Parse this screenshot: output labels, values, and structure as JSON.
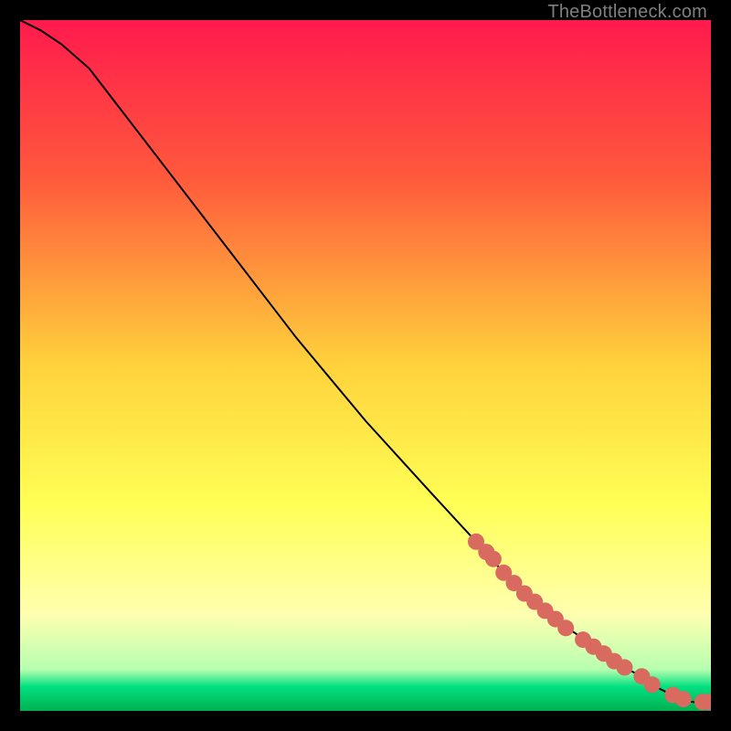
{
  "attribution": "TheBottleneck.com",
  "chart_data": {
    "type": "line",
    "title": "",
    "xlabel": "",
    "ylabel": "",
    "xlim": [
      0,
      100
    ],
    "ylim": [
      0,
      100
    ],
    "grid": false,
    "background_gradient": [
      {
        "offset": 0.0,
        "color": "#ff1a4d"
      },
      {
        "offset": 0.23,
        "color": "#ff5a3c"
      },
      {
        "offset": 0.5,
        "color": "#ffd23c"
      },
      {
        "offset": 0.7,
        "color": "#ffff55"
      },
      {
        "offset": 0.86,
        "color": "#ffffb0"
      },
      {
        "offset": 0.94,
        "color": "#b7ffb0"
      },
      {
        "offset": 0.965,
        "color": "#00e080"
      },
      {
        "offset": 1.0,
        "color": "#00b050"
      }
    ],
    "series": [
      {
        "name": "curve",
        "kind": "line",
        "color": "#000000",
        "x": [
          0,
          3,
          6,
          10,
          20,
          30,
          40,
          50,
          60,
          66,
          70,
          75,
          80,
          85,
          88,
          90,
          92,
          94,
          96,
          98,
          100
        ],
        "y": [
          100,
          98.5,
          96.5,
          93,
          80,
          67,
          54,
          42,
          31,
          24.5,
          20,
          15.5,
          11.5,
          8,
          6,
          5,
          3.5,
          2.5,
          1.5,
          1.2,
          1.2
        ]
      },
      {
        "name": "hotspots",
        "kind": "scatter",
        "color": "#d86a60",
        "radius": 9,
        "x": [
          66,
          67.5,
          68.5,
          70,
          71.5,
          73,
          74.5,
          76,
          77.5,
          79,
          81.5,
          83,
          84.5,
          86,
          87.5,
          90,
          91.5,
          94.5,
          96,
          98.8,
          99.7
        ],
        "y": [
          24.5,
          23,
          22,
          20,
          18.5,
          17,
          15.8,
          14.5,
          13.3,
          12,
          10.3,
          9.3,
          8.3,
          7.2,
          6.3,
          5,
          3.8,
          2.3,
          1.7,
          1.3,
          1.3
        ]
      }
    ]
  }
}
